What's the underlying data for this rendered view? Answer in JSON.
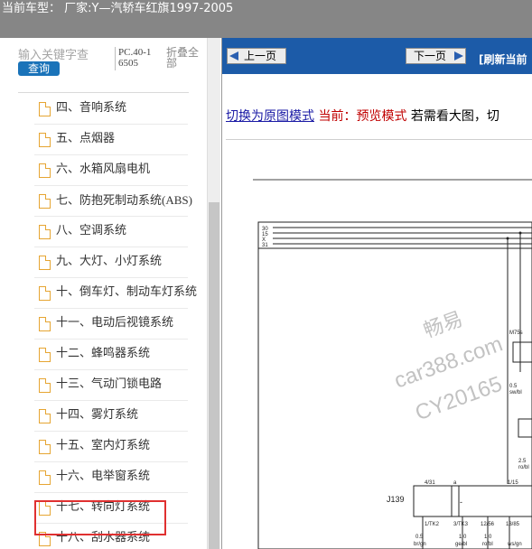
{
  "window": {
    "title": "当前车型： 厂家:Y—汽轿车红旗1997-2005"
  },
  "sidebar": {
    "search_placeholder": "输入关键字查",
    "search_button": "查询",
    "code": "PC.40-16505",
    "collapse_label": "折叠全部",
    "items": [
      {
        "label": "四、音响系统"
      },
      {
        "label": "五、点烟器"
      },
      {
        "label": "六、水箱风扇电机"
      },
      {
        "label": "七、防抱死制动系统(ABS)"
      },
      {
        "label": "八、空调系统"
      },
      {
        "label": "九、大灯、小灯系统"
      },
      {
        "label": "十、倒车灯、制动车灯系统"
      },
      {
        "label": "十一、电动后视镜系统"
      },
      {
        "label": "十二、蜂鸣器系统"
      },
      {
        "label": "十三、气动门锁电路"
      },
      {
        "label": "十四、雾灯系统"
      },
      {
        "label": "十五、室内灯系统"
      },
      {
        "label": "十六、电举窗系统"
      },
      {
        "label": "十七、转向灯系统"
      },
      {
        "label": "十八、刮水器系统"
      }
    ],
    "highlighted_index": 12
  },
  "toolbar": {
    "prev_label": "上一页",
    "next_label": "下一页",
    "refresh_label": "[刷新当前"
  },
  "mode": {
    "switch_link": "切换为原图模式",
    "current_label": "当前：预览模式",
    "tail": "若需看大图，切"
  },
  "diagram": {
    "bus_labels": [
      "30",
      "15",
      "X",
      "31"
    ],
    "component_labels": [
      "M75s",
      "J139",
      "4/31",
      "1/15",
      "a",
      "0.5",
      "sw/bl",
      "2.5",
      "ro/bl",
      "1/TK2",
      "3/TK3",
      "12/56",
      "13/85",
      "0.5",
      "1.0",
      "1.0",
      "br/gn",
      "ge/bl",
      "ro/bl",
      "ws/gn"
    ],
    "watermark_lines": [
      "畅易",
      "car388.com",
      "CY20165"
    ]
  },
  "colors": {
    "topbar": "#868686",
    "navbar": "#1c5ba8",
    "search_button": "#1a73b9",
    "highlight": "#e03030",
    "link": "#1a1aa5",
    "current": "#c00000"
  }
}
